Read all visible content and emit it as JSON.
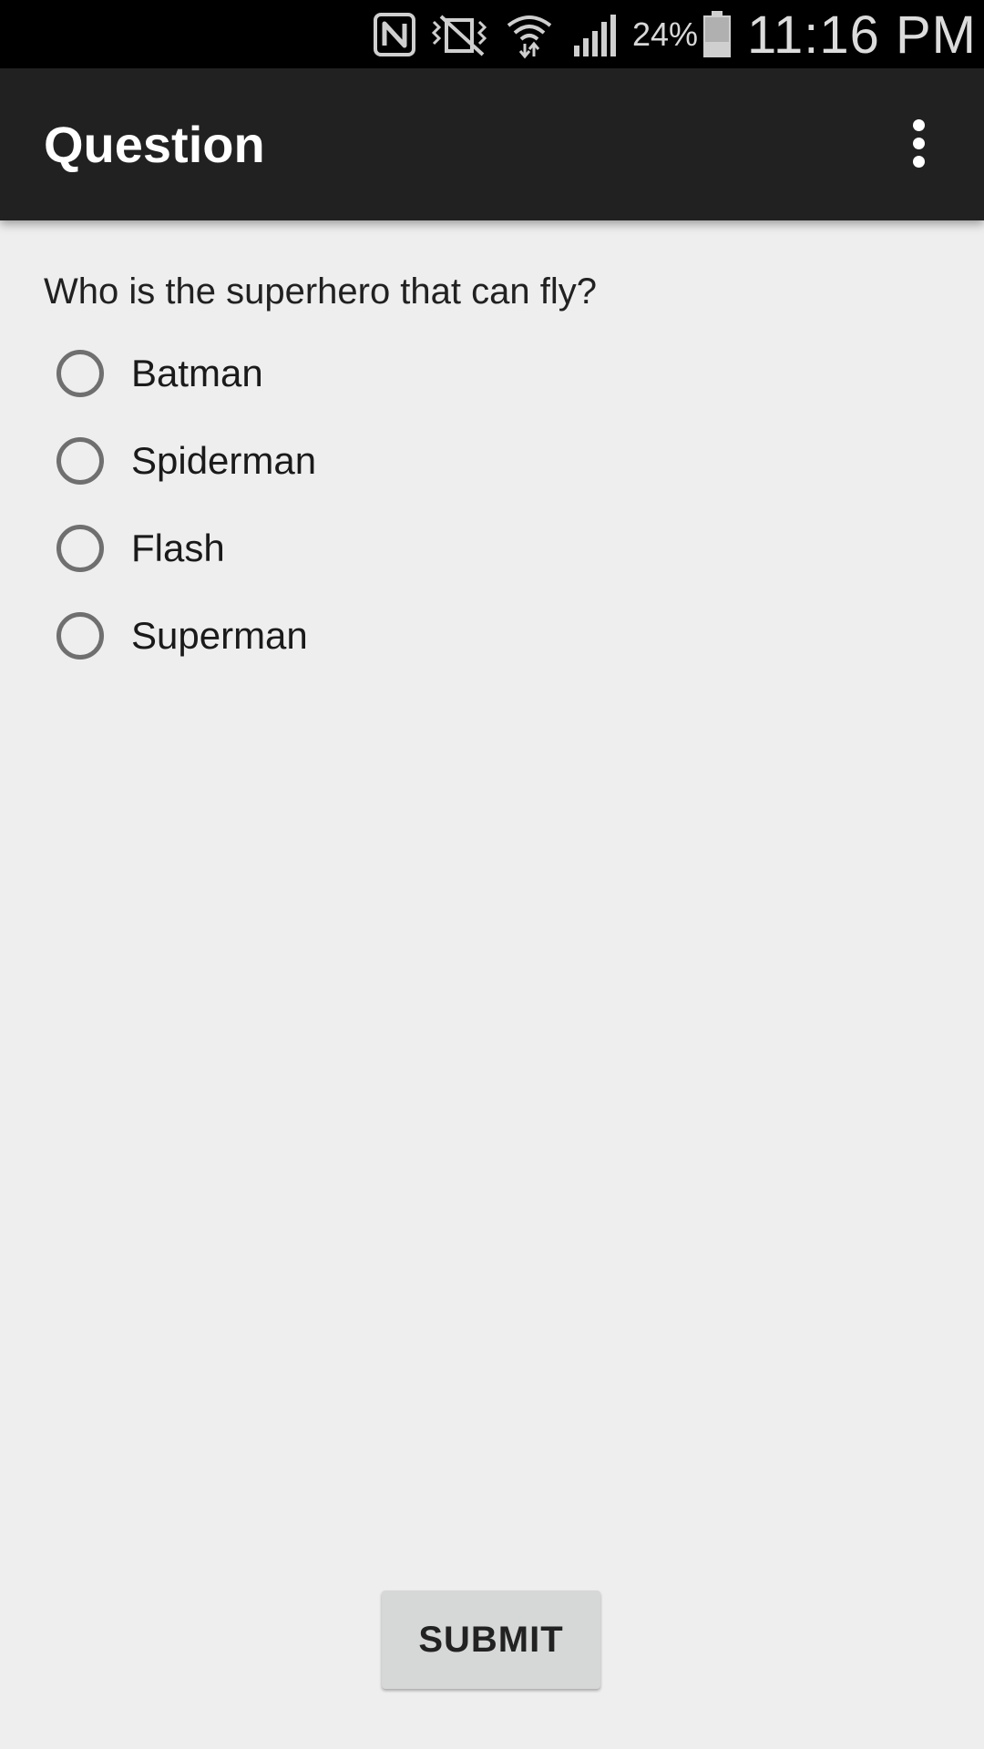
{
  "status_bar": {
    "icons": [
      "nfc-icon",
      "vibrate-icon",
      "wifi-icon",
      "signal-icon",
      "battery-icon"
    ],
    "battery_percent": "24%",
    "time": "11:16 PM"
  },
  "app_bar": {
    "title": "Question",
    "overflow_icon": "more-vert-icon"
  },
  "question": {
    "text": "Who is the superhero that can fly?",
    "options": [
      {
        "label": "Batman",
        "checked": false
      },
      {
        "label": "Spiderman",
        "checked": false
      },
      {
        "label": "Flash",
        "checked": false
      },
      {
        "label": "Superman",
        "checked": false
      }
    ]
  },
  "submit": {
    "label": "SUBMIT"
  },
  "colors": {
    "status_bar": "#000000",
    "app_bar": "#212121",
    "background": "#eeeeee",
    "button": "#d6d7d7"
  }
}
